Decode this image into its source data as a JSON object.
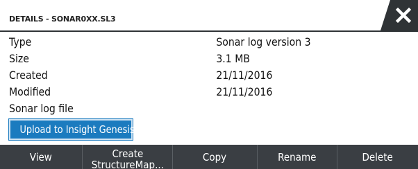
{
  "dialog": {
    "title": "DETAILS - SONAR0XX.SL3",
    "close_icon": "close-icon"
  },
  "details": [
    {
      "label": "Type",
      "value": "Sonar log version 3"
    },
    {
      "label": "Size",
      "value": "3.1 MB"
    },
    {
      "label": "Created",
      "value": "21/11/2016"
    },
    {
      "label": "Modified",
      "value": "21/11/2016"
    },
    {
      "label": "Sonar log file",
      "value": ""
    }
  ],
  "upload_button": "Upload to Insight Genesis",
  "actions": {
    "view": "View",
    "create_line1": "Create",
    "create_line2": "StructureMap...",
    "copy": "Copy",
    "rename": "Rename",
    "delete": "Delete"
  },
  "colors": {
    "accent": "#1b7bbf",
    "bar": "#3a3e43",
    "close_tab": "#2f3336"
  }
}
